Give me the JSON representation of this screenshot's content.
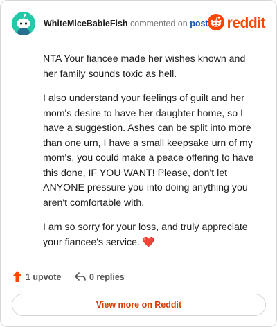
{
  "header": {
    "author": "WhiteMiceBableFish",
    "commented_text": "commented on",
    "post_link": "post",
    "brand_word": "reddit",
    "avatar_icon": "snoo-avatar-icon",
    "logo_icon": "reddit-logo-icon"
  },
  "comment": {
    "paragraphs": [
      "NTA Your fiancee made her wishes known and her family sounds toxic as hell.",
      "I also understand your feelings of guilt and her mom's desire to have her daughter home, so I have a suggestion. Ashes can be split into more than one urn, I have a small keepsake urn of my mom's, you could make a peace offering to have this done, IF YOU WANT! Please, don't let ANYONE pressure you into doing anything you aren't comfortable with.",
      "I am so sorry for your loss, and truly appreciate your fiancee's service."
    ],
    "heart_glyph": "❤️"
  },
  "footer": {
    "upvote_label": "1 upvote",
    "replies_label": "0 replies",
    "view_more_label": "View more on Reddit"
  },
  "colors": {
    "brand": "#ff4500",
    "link": "#0a57c2",
    "avatar_bg": "#24c9a9",
    "view_more": "#d93a00"
  }
}
